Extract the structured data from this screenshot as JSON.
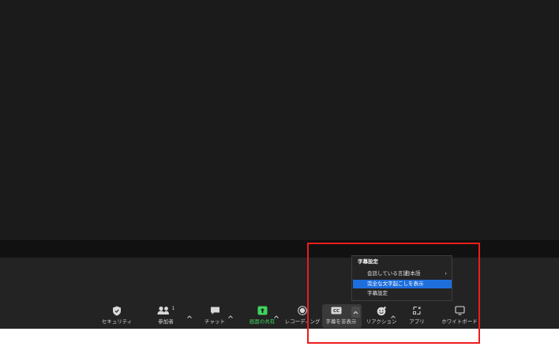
{
  "toolbar": {
    "security_label": "セキュリティ",
    "participants_label": "参加者",
    "participants_count": "1",
    "chat_label": "チャット",
    "share_label": "画面の共有",
    "record_label": "レコーディング",
    "captions_label": "字幕を非表示",
    "captions_icon_text": "CC",
    "reactions_label": "リアクション",
    "apps_label": "アプリ",
    "whiteboard_label": "ホワイトボード"
  },
  "caption_menu": {
    "header": "字幕設定",
    "language_label": "会話している言語:",
    "language_value": "日本語",
    "language_chevron": "›",
    "transcript_label": "完全な文字起こしを表示",
    "settings_label": "字幕設定"
  },
  "colors": {
    "share_green": "#3fd45f",
    "menu_highlight": "#1e6fdc",
    "annotation_red": "#ee1c1c"
  }
}
